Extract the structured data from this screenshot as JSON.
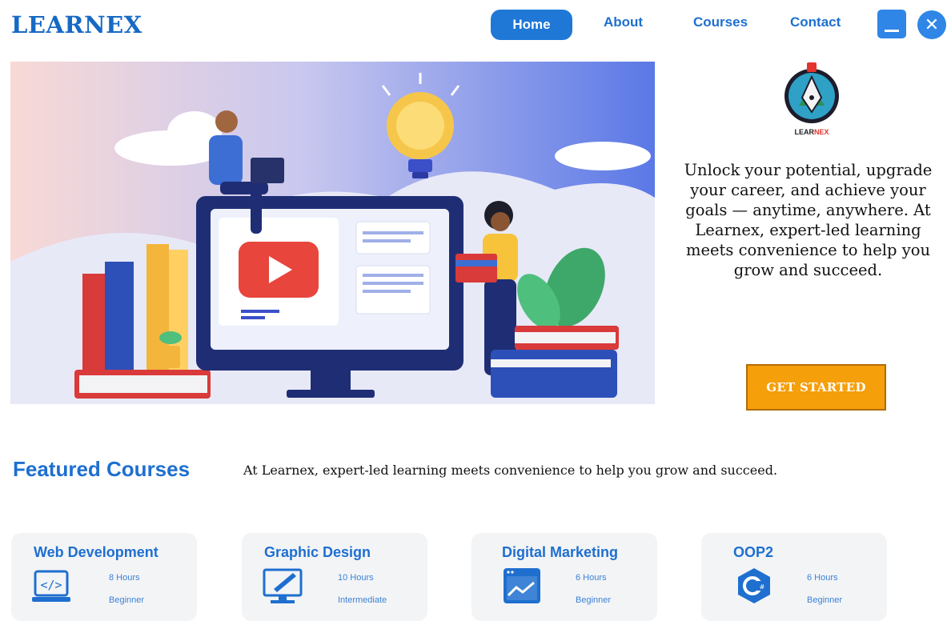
{
  "header": {
    "brand": "LEARNEX",
    "nav": [
      {
        "label": "Home",
        "active": true
      },
      {
        "label": "About"
      },
      {
        "label": "Courses"
      },
      {
        "label": "Contact"
      }
    ],
    "minimize_icon": "minimize-icon",
    "close_icon": "close-icon"
  },
  "hero": {
    "logo_text_a": "LEAR",
    "logo_text_b": "NEX",
    "tagline": "Unlock your potential, upgrade your career, and achieve your goals — anytime, anywhere. At Learnex, expert-led learning meets convenience to help you grow and succeed.",
    "cta_label": "GET STARTED"
  },
  "featured": {
    "title": "Featured Courses",
    "subtitle": "At Learnex, expert-led learning meets convenience to help you grow and succeed.",
    "courses": [
      {
        "title": "Web Development",
        "hours": "8 Hours",
        "level": "Beginner",
        "icon": "code-icon"
      },
      {
        "title": "Graphic Design",
        "hours": "10 Hours",
        "level": "Intermediate",
        "icon": "design-monitor-icon"
      },
      {
        "title": "Digital Marketing",
        "hours": "6 Hours",
        "level": "Beginner",
        "icon": "analytics-icon"
      },
      {
        "title": "OOP2",
        "hours": "6 Hours",
        "level": "Beginner",
        "icon": "csharp-icon"
      }
    ]
  },
  "colors": {
    "accent": "#1e6fcf",
    "cta": "#f59f0b",
    "card_bg": "#f3f4f6"
  }
}
